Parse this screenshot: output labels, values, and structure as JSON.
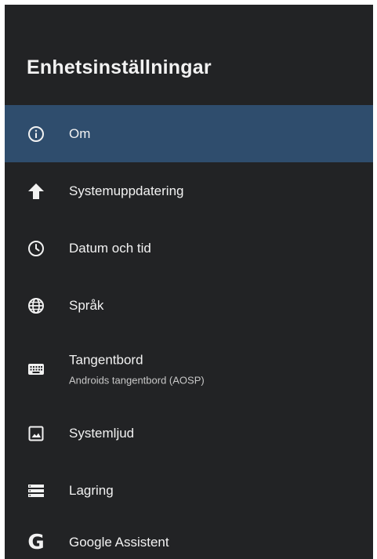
{
  "header": {
    "title": "Enhetsinställningar"
  },
  "menu": {
    "items": [
      {
        "label": "Om",
        "icon": "info-icon",
        "selected": true
      },
      {
        "label": "Systemuppdatering",
        "icon": "arrow-up-icon"
      },
      {
        "label": "Datum och tid",
        "icon": "clock-icon"
      },
      {
        "label": "Språk",
        "icon": "globe-icon"
      },
      {
        "label": "Tangentbord",
        "sublabel": "Androids tangentbord (AOSP)",
        "icon": "keyboard-icon"
      },
      {
        "label": "Systemljud",
        "icon": "image-icon"
      },
      {
        "label": "Lagring",
        "icon": "storage-icon"
      },
      {
        "label": "Google Assistent",
        "icon": "google-icon"
      }
    ]
  },
  "colors": {
    "background": "#222325",
    "selected": "#2f4d6d",
    "text": "#f2f2f2"
  }
}
